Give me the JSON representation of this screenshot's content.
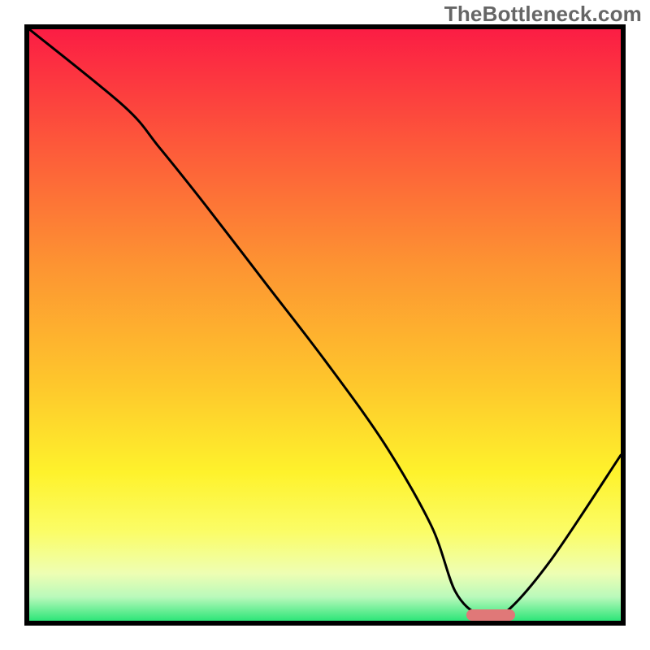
{
  "watermark": "TheBottleneck.com",
  "chart_data": {
    "type": "line",
    "title": "",
    "xlabel": "",
    "ylabel": "",
    "xlim": [
      0,
      100
    ],
    "ylim": [
      0,
      100
    ],
    "series": [
      {
        "name": "bottleneck-curve",
        "x": [
          0,
          16,
          22,
          30,
          40,
          50,
          60,
          68,
          72,
          76,
          80,
          88,
          100
        ],
        "y": [
          100,
          87,
          80,
          70,
          57,
          44,
          30,
          16,
          5,
          1,
          1,
          10,
          28
        ]
      }
    ],
    "annotations": [
      {
        "name": "optimal-marker",
        "x": 78,
        "y": 1
      }
    ],
    "background_gradient": {
      "stops": [
        {
          "offset": 0.0,
          "color": "#fb1d44"
        },
        {
          "offset": 0.2,
          "color": "#fd5a3a"
        },
        {
          "offset": 0.4,
          "color": "#fd9432"
        },
        {
          "offset": 0.6,
          "color": "#fec72c"
        },
        {
          "offset": 0.75,
          "color": "#fef22c"
        },
        {
          "offset": 0.85,
          "color": "#fbfd67"
        },
        {
          "offset": 0.92,
          "color": "#eefeb3"
        },
        {
          "offset": 0.96,
          "color": "#b9f9bb"
        },
        {
          "offset": 1.0,
          "color": "#2de578"
        }
      ]
    }
  }
}
